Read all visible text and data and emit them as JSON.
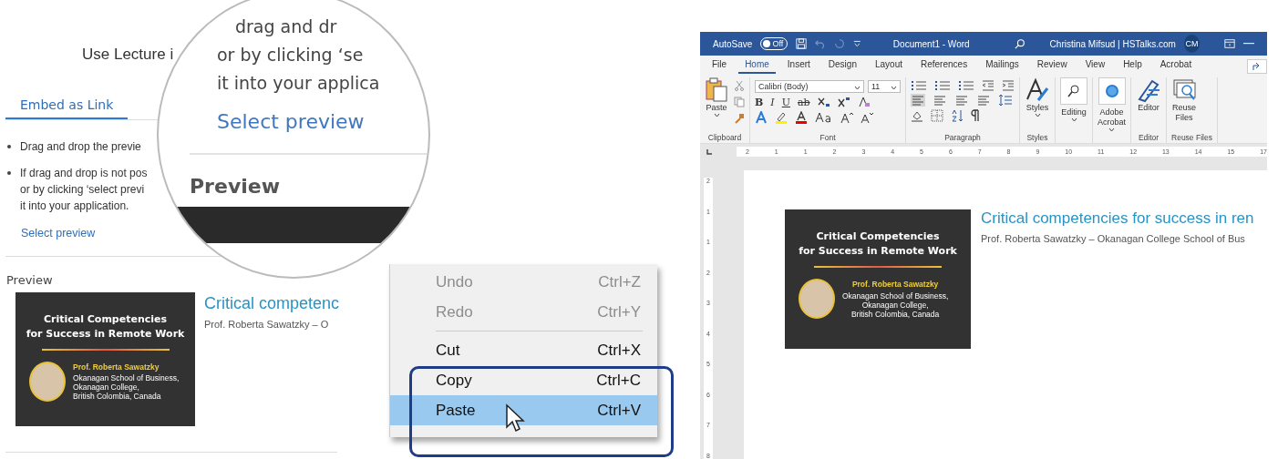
{
  "lecture_panel": {
    "heading": "Use Lecture i",
    "tabs": [
      {
        "label": "Embed as Link",
        "selected": true
      }
    ],
    "instructions": [
      [
        "Drag and drop the previe"
      ],
      [
        "If drag and drop is not pos",
        "or by clicking ‘select previ",
        "it into your application."
      ]
    ],
    "select_link": "Select preview",
    "preview_label": "Preview",
    "preview": {
      "thumbnail": {
        "title_lines": [
          "Critical Competencies",
          "for Success in Remote Work"
        ],
        "presenter": "Prof. Roberta Sawatzky",
        "affiliation_lines": [
          "Okanagan School of Business,",
          "Okanagan College,",
          "British Colombia, Canada"
        ]
      },
      "title": "Critical competenc",
      "byline": "Prof. Roberta Sawatzky – O"
    }
  },
  "magnifier": {
    "lines": [
      "drag and dr",
      "or by clicking ‘se",
      "it into your applica"
    ],
    "link": "Select preview",
    "section": "Preview"
  },
  "context_menu": {
    "items": [
      {
        "label": "Undo",
        "shortcut": "Ctrl+Z",
        "disabled": true,
        "selected": false
      },
      {
        "label": "Redo",
        "shortcut": "Ctrl+Y",
        "disabled": true,
        "selected": false
      },
      {
        "kind": "separator"
      },
      {
        "label": "Cut",
        "shortcut": "Ctrl+X",
        "disabled": false,
        "selected": false
      },
      {
        "label": "Copy",
        "shortcut": "Ctrl+C",
        "disabled": false,
        "selected": false
      },
      {
        "label": "Paste",
        "shortcut": "Ctrl+V",
        "disabled": false,
        "selected": true
      }
    ]
  },
  "word": {
    "title_bar": {
      "autosave": {
        "label": "AutoSave",
        "toggle": "Off",
        "on": false
      },
      "document": "Document1  -  Word",
      "user": "Christina Mifsud | HSTalks.com",
      "initials": "CM"
    },
    "tabs": [
      {
        "label": "File",
        "selected": false
      },
      {
        "label": "Home",
        "selected": true
      },
      {
        "label": "Insert",
        "selected": false
      },
      {
        "label": "Design",
        "selected": false
      },
      {
        "label": "Layout",
        "selected": false
      },
      {
        "label": "References",
        "selected": false
      },
      {
        "label": "Mailings",
        "selected": false
      },
      {
        "label": "Review",
        "selected": false
      },
      {
        "label": "View",
        "selected": false
      },
      {
        "label": "Help",
        "selected": false
      },
      {
        "label": "Acrobat",
        "selected": false
      }
    ],
    "ribbon": {
      "paste": "Paste",
      "font_name": "Calibri (Body)",
      "font_size": "11",
      "format_buttons": [
        "B",
        "I",
        "U",
        "ab"
      ],
      "styles": "Styles",
      "editing": "Editing",
      "acrobat": [
        "Adobe",
        "Acrobat"
      ],
      "editor": "Editor",
      "reuse": [
        "Reuse",
        "Files"
      ],
      "groups": [
        "Clipboard",
        "Font",
        "Paragraph",
        "Styles",
        "Editor",
        "Reuse Files"
      ]
    },
    "ruler": {
      "marks": [
        "2",
        "1",
        "1",
        "2",
        "3",
        "4",
        "5",
        "6",
        "7",
        "8",
        "9",
        "10",
        "11",
        "12",
        "13",
        "14",
        "15",
        "17"
      ],
      "vertical_marks": [
        "2",
        "1",
        "1",
        "2",
        "3",
        "4",
        "5",
        "6",
        "7",
        "8"
      ]
    },
    "page": {
      "thumbnail": {
        "title_lines": [
          "Critical Competencies",
          "for Success in Remote Work"
        ],
        "presenter": "Prof. Roberta Sawatzky",
        "affiliation_lines": [
          "Okanagan School of Business,",
          "Okanagan College,",
          "British Colombia, Canada"
        ]
      },
      "title": "Critical competencies for success in ren",
      "byline": "Prof. Roberta Sawatzky – Okanagan College School of Bus"
    }
  }
}
